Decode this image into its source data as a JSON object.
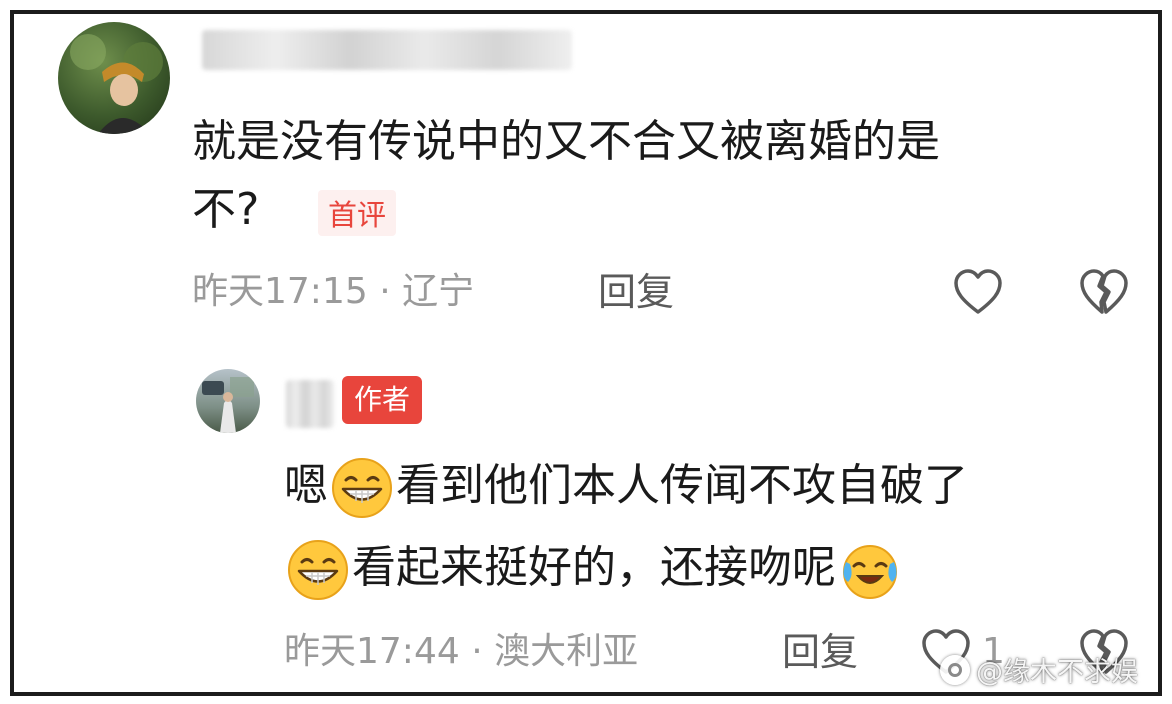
{
  "comment": {
    "text_line1": "就是没有传说中的又不合又被离婚的是",
    "text_line2": "不?",
    "badge": "首评",
    "meta": "昨天17:15 · 辽宁",
    "reply_label": "回复",
    "avatar_icon": "user-avatar",
    "like_icon": "heart-outline-icon",
    "dislike_icon": "broken-heart-icon"
  },
  "reply": {
    "badge": "作者",
    "line1_before_emoji": "嗯",
    "line1_after_emoji": "看到他们本人传闻不攻自破了",
    "line2_after_emoji": "看起来挺好的，还接吻呢",
    "emoji_grin": "grinning-face-emoji",
    "emoji_tears": "tears-of-joy-emoji",
    "meta": "昨天17:44 · 澳大利亚",
    "reply_label": "回复",
    "like_count": "1",
    "avatar_icon": "user-avatar",
    "like_icon": "heart-outline-icon",
    "dislike_icon": "broken-heart-icon"
  },
  "watermark": "@缘木不求娱",
  "colors": {
    "accent_red": "#e8453c",
    "meta_gray": "#9a9a9a",
    "text_dark": "#1a1a1a",
    "frame": "#1c1c1c"
  }
}
